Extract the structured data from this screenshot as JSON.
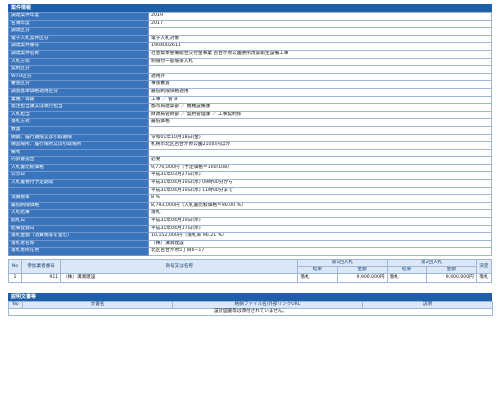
{
  "section_title": "案件情報",
  "info_rows": [
    {
      "label": "調達案件年度",
      "value": "2019"
    },
    {
      "label": "名簿年度",
      "value": "2017"
    },
    {
      "label": "調達区分",
      "value": ""
    },
    {
      "label": "電子入札案件区分",
      "value": "電子入札対象"
    },
    {
      "label": "調達案件番号",
      "value": "1904002611"
    },
    {
      "label": "調達案件名称",
      "value": "社会資本整備総合交付金事業 百合が原公園便所改築衛生設備工事"
    },
    {
      "label": "入札方式",
      "value": "制限付一般競争入札"
    },
    {
      "label": "契約区分",
      "value": ""
    },
    {
      "label": "WTO区分",
      "value": "適用外"
    },
    {
      "label": "審査区分",
      "value": "事後審査"
    },
    {
      "label": "調査基準価格適用区分",
      "value": "最低制限価格適用"
    },
    {
      "label": "業種／等級",
      "value": "工事 ／ 管 B"
    },
    {
      "label": "発注担当課又は執行担当",
      "value": "都市局建築部 ／ 機械設備課"
    },
    {
      "label": "入札担当",
      "value": "財政局管財部 ／ 契約管理課 ／ 工事契約係"
    },
    {
      "label": "落札方式",
      "value": "最低価格"
    },
    {
      "label": "数量",
      "value": ""
    },
    {
      "label": "納期、履行期限又は引取期限",
      "value": "令和01年10月18日(金)"
    },
    {
      "label": "納品場所、履行場所又は引取場所",
      "value": "札幌市北区百合が原公園210の内ほか"
    },
    {
      "label": "備考",
      "value": ""
    },
    {
      "label": "内訳書提出",
      "value": "必要"
    },
    {
      "label": "入札書比較価格",
      "value": "9,770,000円（予定価格＝100/108）"
    },
    {
      "label": "公示日",
      "value": "平成31年03月27日(水)"
    },
    {
      "label": "入札書受付予定期間",
      "value": "平成31年04月10日(水) 09時00分から"
    },
    {
      "label": "",
      "value": "平成31年04月10日(水) 11時00分まで"
    },
    {
      "label": "消費税率",
      "value": "8 %"
    },
    {
      "label": "最低制限価格",
      "value": "8,793,000円（入札書比較価格＝90.00 %）"
    },
    {
      "label": "入札結果",
      "value": "落札"
    },
    {
      "label": "開札日",
      "value": "平成31年04月10日(水)"
    },
    {
      "label": "結果登録日",
      "value": "平成31年04月17日(水)"
    },
    {
      "label": "落札金額（消費税等を含む）",
      "value": "10,152,000円（落札率 96.21 %）"
    },
    {
      "label": "落札者名称",
      "value": "（株）溝渕建設"
    },
    {
      "label": "落札者所在地",
      "value": "北区百合が原5丁目6−17"
    }
  ],
  "results": {
    "headers": {
      "no": "No",
      "bidder_no": "参加業者番号",
      "company": "商号又は名称",
      "round1": "第1回入札",
      "round2": "第2回入札",
      "decision": "決定",
      "result": "結果",
      "amount": "金額"
    },
    "rows": [
      {
        "no": "1",
        "bidder_no": "911",
        "company": "（株）溝渕建設",
        "r1_result": "落札",
        "r1_amount": "9,900,000円",
        "r2_result": "落札",
        "r2_amount": "9,400,000円",
        "decision": "落札"
      }
    ]
  },
  "attachments": {
    "title": "説明文書等",
    "headers": {
      "no": "No",
      "doc_name": "文書名",
      "file_name": "格納ファイル名/外部リンクURL",
      "desc": "説明"
    },
    "empty_message": "設計図書等は添付されていません。"
  }
}
